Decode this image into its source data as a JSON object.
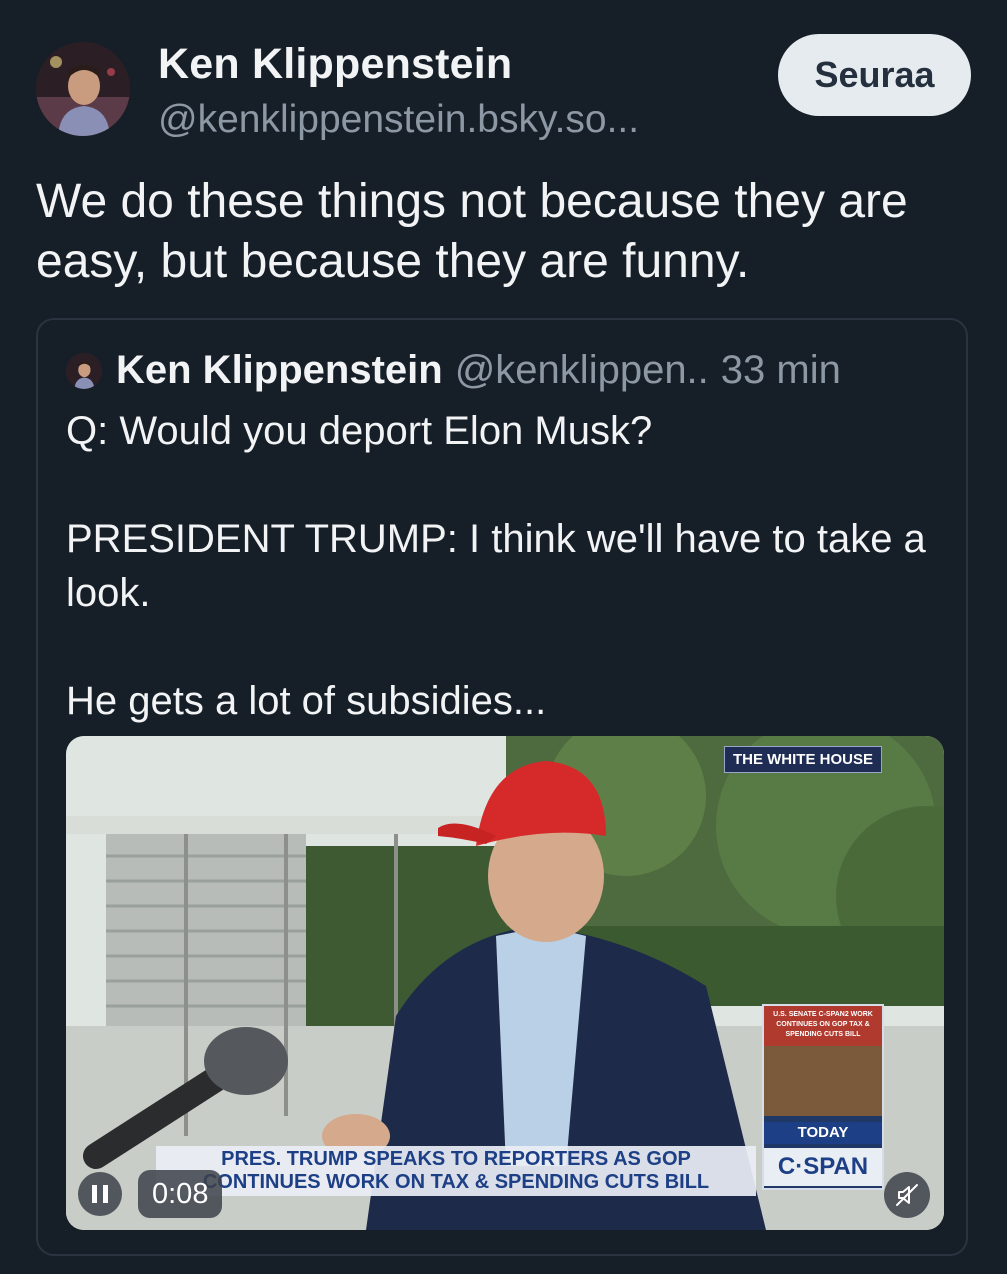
{
  "author": {
    "display_name": "Ken Klippenstein",
    "handle": "@kenklippenstein.bsky.so..."
  },
  "follow_label": "Seuraa",
  "post_text": "We do these things not because they are easy, but because they are funny.",
  "quote": {
    "display_name": "Ken Klippenstein",
    "handle": "@kenklippen..",
    "time": "33 min",
    "text": "Q: Would you deport Elon Musk?\n\nPRESIDENT TRUMP: I think we'll have to take a look.\n\nHe gets a lot of subsidies..."
  },
  "video": {
    "badge": "THE WHITE HOUSE",
    "cspan_top": "U.S. SENATE C-SPAN2 WORK CONTINUES ON GOP TAX & SPENDING CUTS BILL",
    "cspan_today": "TODAY",
    "cspan_logo": "C·SPAN",
    "chyron_line1": "PRES. TRUMP SPEAKS TO REPORTERS AS GOP",
    "chyron_line2": "CONTINUES WORK ON TAX & SPENDING CUTS BILL",
    "elapsed": "0:08",
    "icons": {
      "pause": "pause-icon",
      "mute": "muted-speaker-icon"
    }
  }
}
